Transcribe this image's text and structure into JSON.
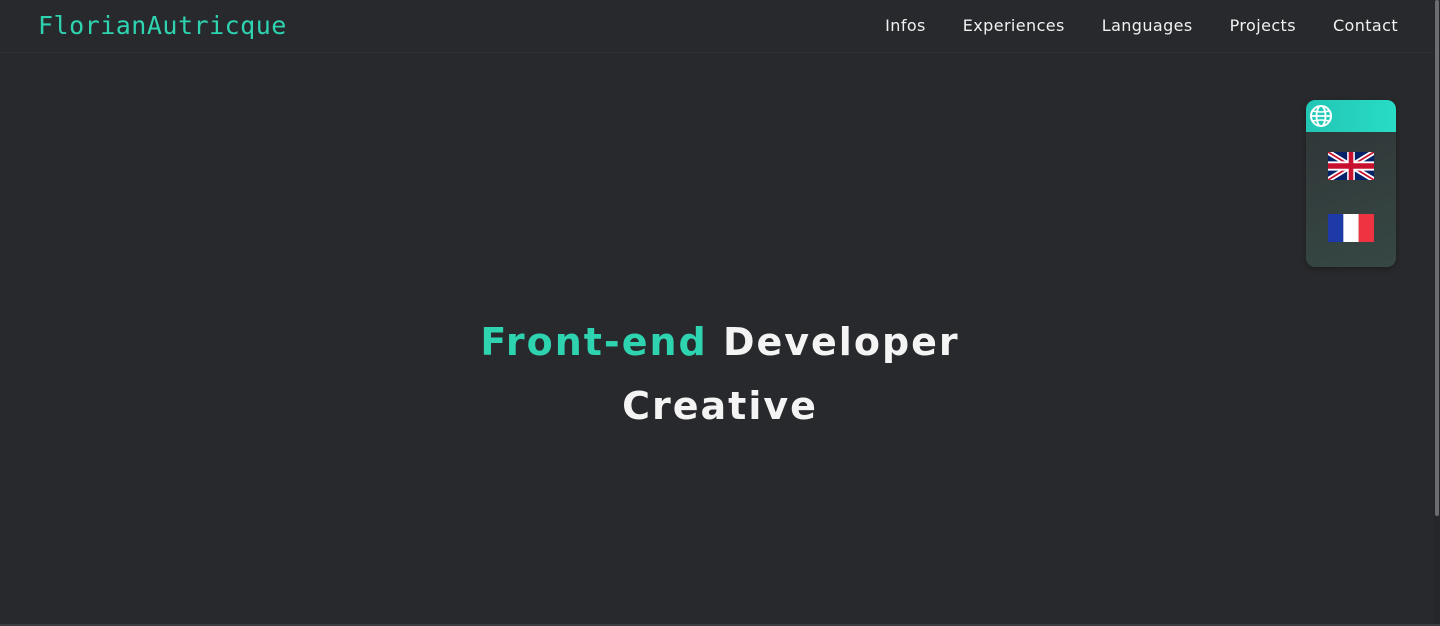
{
  "header": {
    "logo": "FlorianAutricque",
    "nav": [
      "Infos",
      "Experiences",
      "Languages",
      "Projects",
      "Contact"
    ]
  },
  "language_switcher": {
    "header_icon": "globe-icon",
    "options": [
      {
        "name": "flag-uk-icon"
      },
      {
        "name": "flag-fr-icon"
      }
    ]
  },
  "hero": {
    "line1_accent": "Front-end",
    "line1_rest": "Developer",
    "line2": "Creative"
  },
  "colors": {
    "background": "#28292c",
    "accent": "#2ed3b0",
    "text": "#f4f4f4"
  }
}
